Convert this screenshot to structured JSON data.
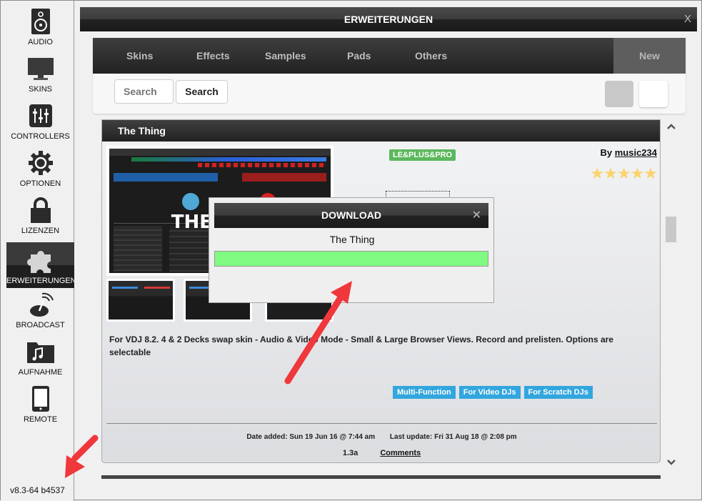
{
  "sidebar": {
    "items": [
      {
        "label": "AUDIO",
        "icon": "speaker-icon",
        "active": false
      },
      {
        "label": "SKINS",
        "icon": "monitor-icon",
        "active": false
      },
      {
        "label": "CONTROLLERS",
        "icon": "sliders-icon",
        "active": false
      },
      {
        "label": "OPTIONEN",
        "icon": "gear-icon",
        "active": false
      },
      {
        "label": "LIZENZEN",
        "icon": "lock-icon",
        "active": false
      },
      {
        "label": "ERWEITERUNGEN",
        "icon": "puzzle-icon",
        "active": true
      },
      {
        "label": "BROADCAST",
        "icon": "broadcast-icon",
        "active": false
      },
      {
        "label": "AUFNAHME",
        "icon": "music-folder-icon",
        "active": false
      },
      {
        "label": "REMOTE",
        "icon": "phone-icon",
        "active": false
      }
    ],
    "version": "v8.3-64 b4537"
  },
  "window": {
    "title": "ERWEITERUNGEN",
    "close_label": "X"
  },
  "tabs": {
    "items": [
      "Skins",
      "Effects",
      "Samples",
      "Pads",
      "Others"
    ],
    "new_label": "New"
  },
  "search": {
    "placeholder": "Search",
    "button_label": "Search"
  },
  "item": {
    "title": "The Thing",
    "compatibility": "LE&PLUS&PRO",
    "author_prefix": "By",
    "author": "music234",
    "rating": 5,
    "rating_max": 5,
    "stars": "★★★★★",
    "screenshot_overlay_text": "THE",
    "description": "For VDJ 8.2. 4 & 2 Decks swap skin - Audio & Video Mode - Small & Large Browser Views. Record and prelisten. Options are selectable",
    "tags": [
      "Multi-Function",
      "For Video DJs",
      "For Scratch DJs"
    ],
    "date_added": "Date added: Sun 19 Jun 16 @ 7:44 am",
    "last_update": "Last update: Fri 31 Aug 18 @ 2:08 pm",
    "version": "1.3a",
    "comments_label": "Comments"
  },
  "download_dialog": {
    "title": "DOWNLOAD",
    "close_label": "✕",
    "item_name": "The Thing",
    "progress_percent": 100,
    "progress_color": "#80fa80"
  },
  "colors": {
    "tag_blue": "#32a6de",
    "badge_green": "#5cb85c",
    "star_yellow": "#f9d36b",
    "arrow_red": "#f0373c"
  }
}
